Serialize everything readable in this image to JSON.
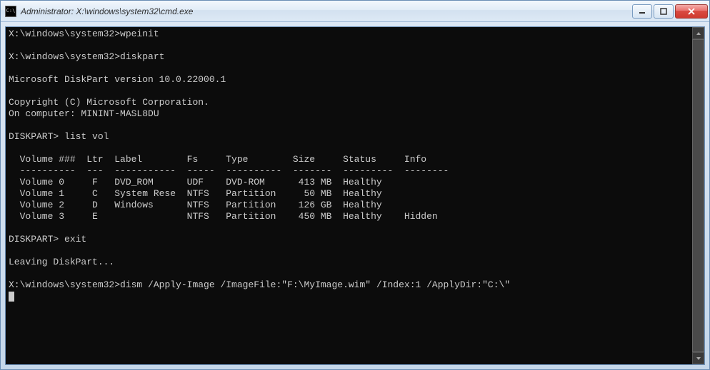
{
  "window": {
    "title": "Administrator: X:\\windows\\system32\\cmd.exe",
    "icon_label": "C:\\"
  },
  "console": {
    "prompt_path": "X:\\windows\\system32>",
    "cmd1": "wpeinit",
    "cmd2": "diskpart",
    "diskpart_version": "Microsoft DiskPart version 10.0.22000.1",
    "copyright": "Copyright (C) Microsoft Corporation.",
    "computer": "On computer: MININT-MASL8DU",
    "dp_prompt": "DISKPART>",
    "cmd3": "list vol",
    "header": "  Volume ###  Ltr  Label        Fs     Type        Size     Status     Info",
    "divider": "  ----------  ---  -----------  -----  ----------  -------  ---------  --------",
    "volumes": [
      "  Volume 0     F   DVD_ROM      UDF    DVD-ROM      413 MB  Healthy",
      "  Volume 1     C   System Rese  NTFS   Partition     50 MB  Healthy",
      "  Volume 2     D   Windows      NTFS   Partition    126 GB  Healthy",
      "  Volume 3     E                NTFS   Partition    450 MB  Healthy    Hidden"
    ],
    "cmd4": "exit",
    "leaving": "Leaving DiskPart...",
    "cmd5": "dism /Apply-Image /ImageFile:\"F:\\MyImage.wim\" /Index:1 /ApplyDir:\"C:\\\""
  },
  "chart_data": {
    "type": "table",
    "title": "DISKPART list vol",
    "columns": [
      "Volume ###",
      "Ltr",
      "Label",
      "Fs",
      "Type",
      "Size",
      "Status",
      "Info"
    ],
    "rows": [
      {
        "Volume ###": "Volume 0",
        "Ltr": "F",
        "Label": "DVD_ROM",
        "Fs": "UDF",
        "Type": "DVD-ROM",
        "Size": "413 MB",
        "Status": "Healthy",
        "Info": ""
      },
      {
        "Volume ###": "Volume 1",
        "Ltr": "C",
        "Label": "System Rese",
        "Fs": "NTFS",
        "Type": "Partition",
        "Size": "50 MB",
        "Status": "Healthy",
        "Info": ""
      },
      {
        "Volume ###": "Volume 2",
        "Ltr": "D",
        "Label": "Windows",
        "Fs": "NTFS",
        "Type": "Partition",
        "Size": "126 GB",
        "Status": "Healthy",
        "Info": ""
      },
      {
        "Volume ###": "Volume 3",
        "Ltr": "E",
        "Label": "",
        "Fs": "NTFS",
        "Type": "Partition",
        "Size": "450 MB",
        "Status": "Healthy",
        "Info": "Hidden"
      }
    ]
  }
}
